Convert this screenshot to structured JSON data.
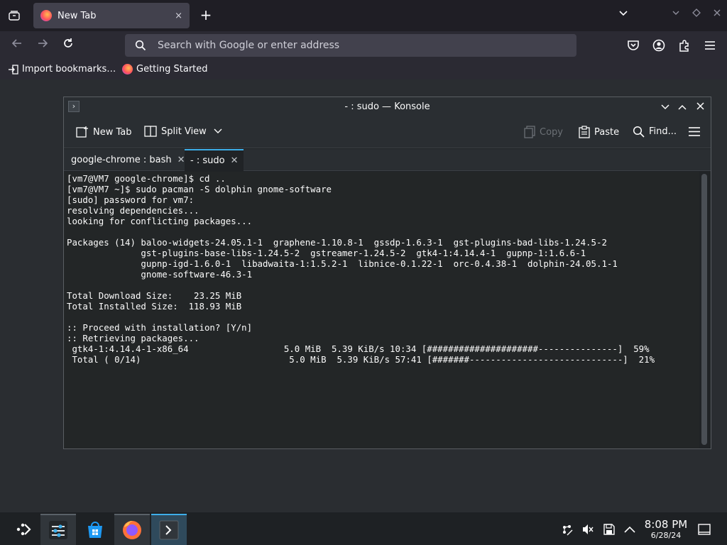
{
  "browser": {
    "tab_title": "New Tab",
    "tab_close": "×",
    "new_tab_symbol": "+",
    "search_placeholder": "Search with Google or enter address",
    "bookmarks": [
      {
        "label": "Import bookmarks…"
      },
      {
        "label": "Getting Started"
      }
    ],
    "icons": [
      "list-all-tabs-icon",
      "back-icon",
      "forward-icon",
      "reload-icon",
      "search-icon",
      "pocket-icon",
      "account-icon",
      "extensions-icon",
      "menu-icon"
    ]
  },
  "konsole": {
    "window_title": "- : sudo — Konsole",
    "toolbar": {
      "new_tab": "New Tab",
      "split_view": "Split View",
      "copy": "Copy",
      "paste": "Paste",
      "find": "Find..."
    },
    "tabs": [
      {
        "label": "google-chrome : bash"
      },
      {
        "label": "- : sudo"
      }
    ],
    "terminal_text": "[vm7@VM7 google-chrome]$ cd ..\n[vm7@VM7 ~]$ sudo pacman -S dolphin gnome-software\n[sudo] password for vm7:\nresolving dependencies...\nlooking for conflicting packages...\n\nPackages (14) baloo-widgets-24.05.1-1  graphene-1.10.8-1  gssdp-1.6.3-1  gst-plugins-bad-libs-1.24.5-2\n              gst-plugins-base-libs-1.24.5-2  gstreamer-1.24.5-2  gtk4-1:4.14.4-1  gupnp-1:1.6.6-1\n              gupnp-igd-1.6.0-1  libadwaita-1:1.5.2-1  libnice-0.1.22-1  orc-0.4.38-1  dolphin-24.05.1-1\n              gnome-software-46.3-1\n\nTotal Download Size:    23.25 MiB\nTotal Installed Size:  118.93 MiB\n\n:: Proceed with installation? [Y/n]\n:: Retrieving packages...\n gtk4-1:4.14.4-1-x86_64                  5.0 MiB  5.39 KiB/s 10:34 [#####################---------------]  59%\n Total ( 0/14)                            5.0 MiB  5.39 KiB/s 57:41 [#######-----------------------------]  21%"
  },
  "taskbar": {
    "time": "8:08 PM",
    "date": "6/28/24",
    "apps": [
      "application-launcher-icon",
      "system-settings-icon",
      "discover-store-icon",
      "firefox-icon",
      "konsole-icon"
    ],
    "tray": [
      "network-icon",
      "volume-muted-icon",
      "save-icon",
      "show-hidden-icons-icon",
      "show-desktop-icon"
    ]
  }
}
